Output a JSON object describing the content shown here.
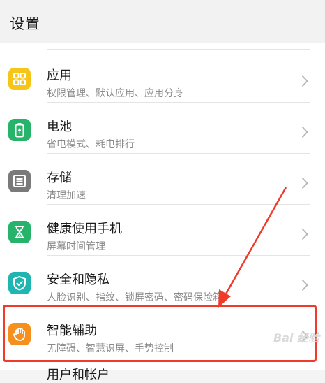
{
  "header": {
    "title": "设置"
  },
  "items": [
    {
      "label": "应用",
      "sub": "权限管理、默认应用、应用分身",
      "icon": "apps-grid-icon",
      "color": "#f5c518"
    },
    {
      "label": "电池",
      "sub": "省电模式、耗电排行",
      "icon": "battery-icon",
      "color": "#27b36a"
    },
    {
      "label": "存储",
      "sub": "清理加速",
      "icon": "storage-icon",
      "color": "#7a7a7a"
    },
    {
      "label": "健康使用手机",
      "sub": "屏幕时间管理",
      "icon": "hourglass-icon",
      "color": "#27b36a"
    },
    {
      "label": "安全和隐私",
      "sub": "人脸识别、指纹、锁屏密码、密码保险箱",
      "icon": "shield-check-icon",
      "color": "#1fb5b0"
    },
    {
      "label": "智能辅助",
      "sub": "无障碍、智慧识屏、手势控制",
      "icon": "hand-icon",
      "color": "#f5901e"
    }
  ],
  "peek_item": {
    "label": "用户和帐户"
  },
  "watermark": "Bai 经验",
  "annotation": {
    "color": "#f03a2a"
  }
}
